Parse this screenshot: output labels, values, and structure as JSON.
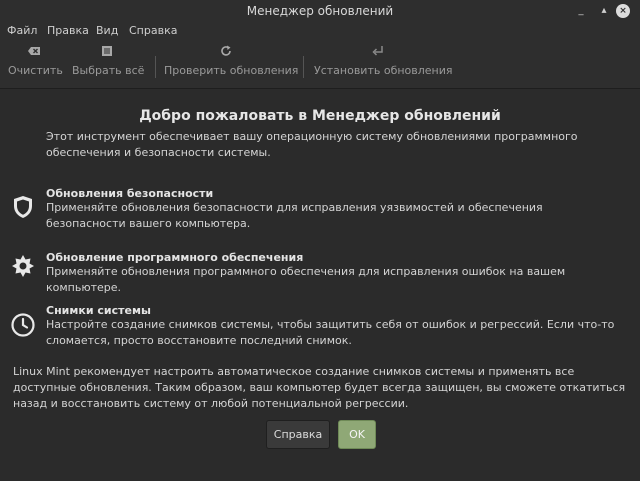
{
  "window": {
    "title": "Менеджер обновлений",
    "controls": {
      "minimize": "_",
      "maximize": "▴",
      "close": "×"
    }
  },
  "menu": {
    "items": [
      "Файл",
      "Правка",
      "Вид",
      "Справка"
    ]
  },
  "toolbar": {
    "clear": {
      "label": "Очистить",
      "icon": "clear-icon"
    },
    "select_all": {
      "label": "Выбрать всё",
      "icon": "select-all-icon"
    },
    "refresh": {
      "label": "Проверить обновления",
      "icon": "refresh-icon"
    },
    "install": {
      "label": "Установить обновления",
      "icon": "install-icon"
    }
  },
  "welcome": {
    "heading": "Добро пожаловать в Менеджер обновлений",
    "intro": "Этот инструмент обеспечивает вашу операционную систему обновлениями программного обеспечения и безопасности системы.",
    "features": [
      {
        "title": "Обновления безопасности",
        "description": "Применяйте обновления безопасности для исправления уязвимостей и обеспечения безопасности вашего компьютера.",
        "icon": "shield-icon"
      },
      {
        "title": "Обновление программного обеспечения",
        "description": "Применяйте обновления программного обеспечения для исправления ошибок на вашем компьютере.",
        "icon": "gear-icon"
      },
      {
        "title": "Снимки системы",
        "description": "Настройте создание снимков системы, чтобы защитить себя от ошибок и регрессий. Если что-то сломается, просто восстановите последний снимок.",
        "icon": "clock-icon"
      }
    ],
    "recommendation": "Linux Mint рекомендует настроить автоматическое создание снимков системы и применять все доступные обновления. Таким образом, ваш компьютер будет всегда защищен, вы сможете откатиться назад и восстановить систему от любой потенциальной регрессии."
  },
  "buttons": {
    "help": "Справка",
    "ok": "OK"
  },
  "colors": {
    "background": "#2b2b2b",
    "ok_button": "#8fa876"
  }
}
